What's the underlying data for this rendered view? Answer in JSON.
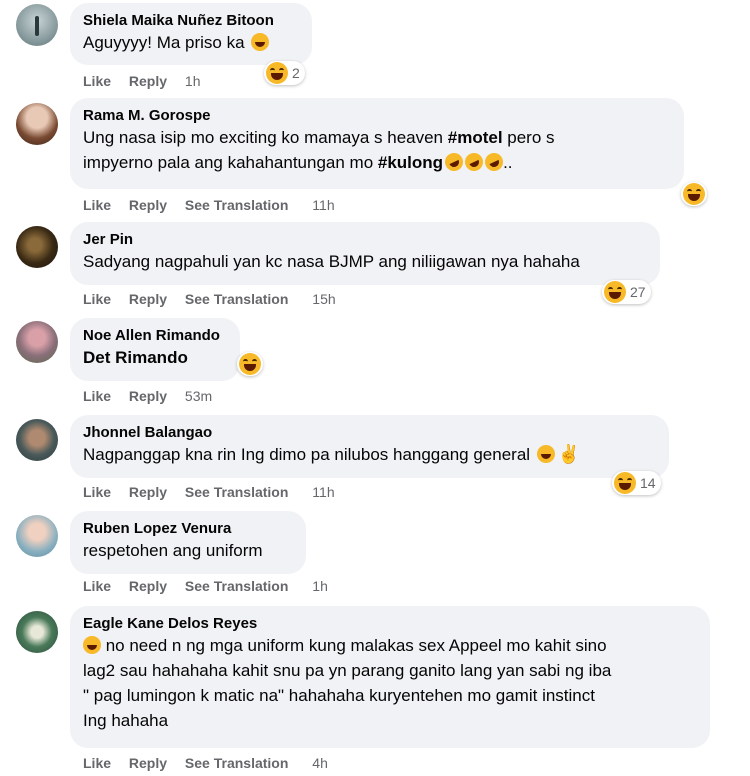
{
  "actions": {
    "like": "Like",
    "reply": "Reply",
    "see_translation": "See Translation"
  },
  "comments": [
    {
      "author": "Shiela Maika Nuñez Bitoon",
      "text": "Aguyyyy! Ma priso ka",
      "time": "1h",
      "reaction_count": "2"
    },
    {
      "author": "Rama M. Gorospe",
      "line1": "Ung nasa isip mo exciting ko mamaya s heaven ",
      "tag1": "#motel",
      "line1b": " pero s",
      "line2": "impyerno pala ang kahahantungan mo ",
      "tag2": "#kulong",
      "line2b": "..",
      "time": "11h",
      "reaction_count": ""
    },
    {
      "author": "Jer Pin",
      "text": "Sadyang nagpahuli yan kc nasa BJMP ang niliigawan nya hahaha",
      "time": "15h",
      "reaction_count": "27"
    },
    {
      "author": "Noe Allen Rimando",
      "text": "Det Rimando",
      "time": "53m",
      "reaction_count": ""
    },
    {
      "author": "Jhonnel Balangao",
      "text": "Nagpanggap kna rin Ing dimo pa nilubos hanggang general",
      "time": "11h",
      "reaction_count": "14"
    },
    {
      "author": "Ruben Lopez Venura",
      "text": "respetohen ang uniform",
      "time": "1h",
      "reaction_count": ""
    },
    {
      "author": "Eagle Kane Delos Reyes",
      "line1": " no need n ng mga uniform kung malakas sex Appeel mo kahit sino",
      "line2": "lag2 sau hahahaha kahit snu pa yn parang ganito lang yan sabi ng iba",
      "line3": "\" pag lumingon k matic na\" hahahaha kuryentehen mo gamit instinct",
      "line4": "Ing hahaha",
      "time": "4h"
    }
  ]
}
